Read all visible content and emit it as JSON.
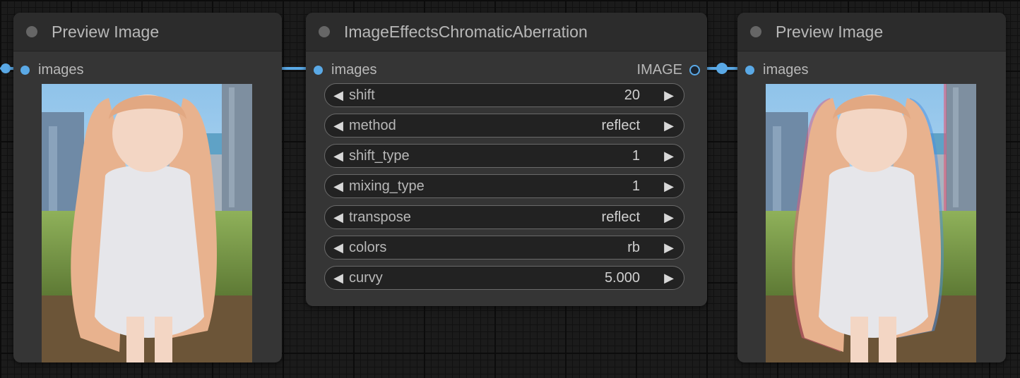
{
  "nodes": {
    "preview_left": {
      "title": "Preview Image",
      "input_label": "images"
    },
    "chromatic": {
      "title": "ImageEffectsChromaticAberration",
      "input_label": "images",
      "output_label": "IMAGE",
      "widgets": [
        {
          "name": "shift",
          "value": "20"
        },
        {
          "name": "method",
          "value": "reflect"
        },
        {
          "name": "shift_type",
          "value": "1"
        },
        {
          "name": "mixing_type",
          "value": "1"
        },
        {
          "name": "transpose",
          "value": "reflect"
        },
        {
          "name": "colors",
          "value": "rb"
        },
        {
          "name": "curvy",
          "value": "5.000"
        }
      ]
    },
    "preview_right": {
      "title": "Preview Image",
      "input_label": "images"
    }
  },
  "colors": {
    "link": "#5aa9e6",
    "node_bg": "#353535",
    "title_bg": "#2c2c2c",
    "canvas": "#1b1b1b"
  },
  "icons": {
    "decrement": "left-triangle",
    "increment": "right-triangle"
  }
}
